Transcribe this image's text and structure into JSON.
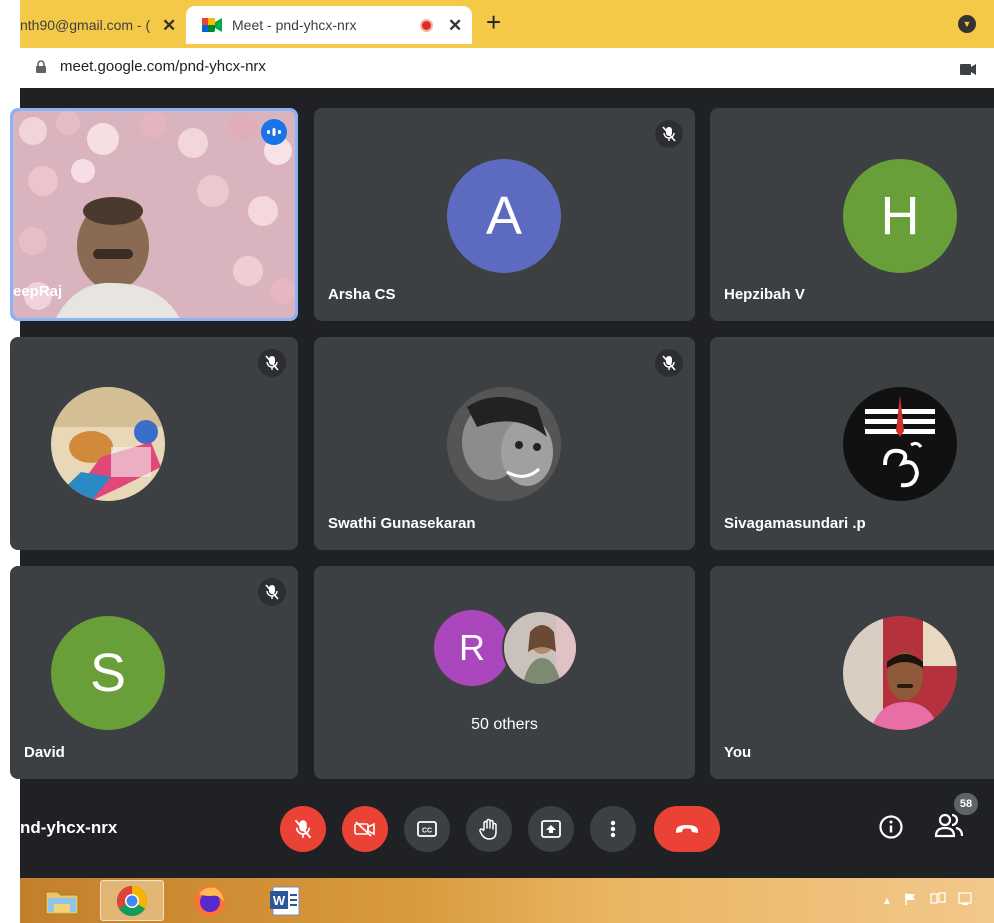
{
  "browser": {
    "tabs": [
      {
        "title": "nth90@gmail.com - (",
        "close": "✕"
      },
      {
        "title": "Meet - pnd-yhcx-nrx",
        "close": "✕"
      }
    ],
    "new_tab_label": "+",
    "url": "meet.google.com/pnd-yhcx-nrx"
  },
  "meet": {
    "tiles": [
      {
        "name": "eepRaj",
        "type": "video",
        "speaking": true
      },
      {
        "name": "Arsha CS",
        "type": "letter",
        "letter": "A",
        "color": "#5c6bc0",
        "muted": true
      },
      {
        "name": "Hepzibah V",
        "type": "letter",
        "letter": "H",
        "color": "#689f38",
        "muted": false
      },
      {
        "name": "",
        "type": "photo",
        "muted": true
      },
      {
        "name": "Swathi Gunasekaran",
        "type": "photo",
        "muted": true
      },
      {
        "name": "Sivagamasundari .p",
        "type": "photo",
        "muted": false
      },
      {
        "name": "David",
        "type": "letter",
        "letter": "S",
        "color": "#689f38",
        "muted": true
      },
      {
        "name": "50 others",
        "type": "group",
        "letter": "R",
        "color": "#ab47bc"
      },
      {
        "name": "You",
        "type": "photo",
        "muted": false
      }
    ],
    "meeting_code": "nd-yhcx-nrx",
    "participant_count": "58"
  },
  "colors": {
    "tab_strip": "#f4c948",
    "meet_bg": "#202124",
    "tile_bg": "#3c4043",
    "danger": "#ea4335",
    "active_speaker_border": "#8ab4f8"
  }
}
